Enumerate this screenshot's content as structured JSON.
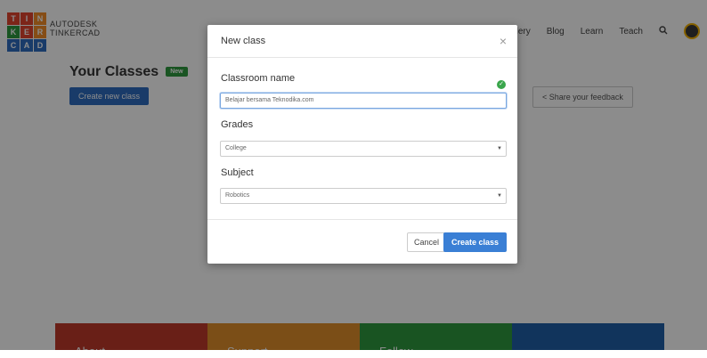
{
  "brand": {
    "line1": "AUTODESK",
    "line2": "TINKERCAD",
    "logo_letters": [
      "T",
      "I",
      "N",
      "K",
      "E",
      "R",
      "C",
      "A",
      "D"
    ]
  },
  "topnav": {
    "items": [
      "llery",
      "Blog",
      "Learn",
      "Teach"
    ]
  },
  "classes": {
    "title": "Your Classes",
    "new_badge": "New",
    "create_button": "Create new class",
    "feedback_button": "Share your feedback"
  },
  "footer": {
    "columns": [
      "About",
      "Support",
      "Follow",
      ""
    ]
  },
  "modal": {
    "title": "New class",
    "close": "×",
    "classroom_label": "Classroom name",
    "classroom_value": "Belajar bersama Teknodika.com",
    "grades_label": "Grades",
    "grades_value": "College",
    "subject_label": "Subject",
    "subject_value": "Robotics",
    "cancel_label": "Cancel",
    "create_label": "Create class"
  },
  "colors": {
    "primary_blue": "#3a7fd5",
    "footer": [
      "#c0392b",
      "#e08e2a",
      "#2e9a3e",
      "#1f5fa8"
    ],
    "logo": [
      "#e2442f",
      "#e2442f",
      "#f28c28",
      "#2e9a3e",
      "#e2442f",
      "#f28c28",
      "#2f6cc0",
      "#2f6cc0",
      "#2f6cc0"
    ]
  }
}
